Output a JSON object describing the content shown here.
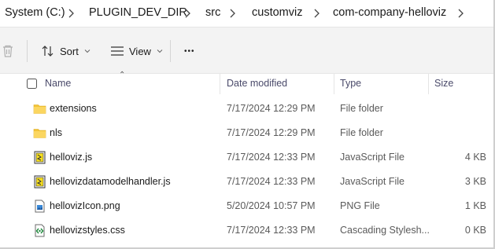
{
  "breadcrumb": {
    "items": [
      "System (C:)",
      "PLUGIN_DEV_DIR",
      "src",
      "customviz",
      "com-company-helloviz"
    ]
  },
  "toolbar": {
    "sort_label": "Sort",
    "view_label": "View",
    "more_label": "•••"
  },
  "columns": {
    "name": "Name",
    "date": "Date modified",
    "type": "Type",
    "size": "Size"
  },
  "files": [
    {
      "name": "extensions",
      "date": "7/17/2024 12:29 PM",
      "type": "File folder",
      "size": "",
      "icon": "folder-icon"
    },
    {
      "name": "nls",
      "date": "7/17/2024 12:29 PM",
      "type": "File folder",
      "size": "",
      "icon": "folder-icon"
    },
    {
      "name": "helloviz.js",
      "date": "7/17/2024 12:33 PM",
      "type": "JavaScript File",
      "size": "4 KB",
      "icon": "javascript-file-icon"
    },
    {
      "name": "hellovizdatamodelhandler.js",
      "date": "7/17/2024 12:33 PM",
      "type": "JavaScript File",
      "size": "3 KB",
      "icon": "javascript-file-icon"
    },
    {
      "name": "hellovizIcon.png",
      "date": "5/20/2024 10:57 PM",
      "type": "PNG File",
      "size": "1 KB",
      "icon": "image-file-icon"
    },
    {
      "name": "hellovizstyles.css",
      "date": "7/17/2024 12:33 PM",
      "type": "Cascading Stylesh...",
      "size": "0 KB",
      "icon": "css-file-icon"
    }
  ]
}
